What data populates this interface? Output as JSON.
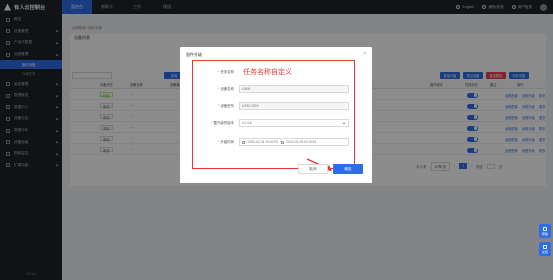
{
  "app": {
    "title": "有人云控制台",
    "version": "V3.1.0"
  },
  "topnav": [
    {
      "label": "监控台",
      "active": true
    },
    {
      "label": "物联卡",
      "active": false
    },
    {
      "label": "工作",
      "active": false
    },
    {
      "label": "模组",
      "active": false
    }
  ],
  "topright": {
    "lang": "English",
    "bell": "通知/反馈",
    "user": "用户信息"
  },
  "sidebar": {
    "items": [
      {
        "label": "概览",
        "icon": "home-icon"
      },
      {
        "label": "设备管理",
        "icon": "device-icon",
        "expand": true
      },
      {
        "label": "产品与数据",
        "icon": "product-icon",
        "expand": true
      },
      {
        "label": "远程管理",
        "icon": "remote-icon",
        "expand": true
      }
    ],
    "subitems": [
      {
        "label": "固件设备",
        "active": true
      },
      {
        "label": "升级任务",
        "active": false
      }
    ],
    "items2": [
      {
        "label": "组态管理",
        "icon": "config-icon"
      },
      {
        "label": "数据转发",
        "icon": "forward-icon"
      },
      {
        "label": "数据中心",
        "icon": "data-icon"
      },
      {
        "label": "设备日志",
        "icon": "log-icon"
      },
      {
        "label": "数据分析",
        "icon": "analysis-icon"
      },
      {
        "label": "设备运维",
        "icon": "ops-icon"
      },
      {
        "label": "视频监控",
        "icon": "video-icon"
      },
      {
        "label": "扩展功能",
        "icon": "ext-icon"
      }
    ]
  },
  "breadcrumb": "远程管理 / 固件设备",
  "card": {
    "title": "设备列表"
  },
  "toolbar": {
    "buttons": [
      {
        "label": "查询",
        "color": "#2d6ee8"
      },
      {
        "label": "批量升级",
        "color": "#2d6ee8"
      },
      {
        "label": "导出设备",
        "color": "#2d6ee8"
      },
      {
        "label": "批量删除",
        "color": "#e8445a"
      },
      {
        "label": "同步设备",
        "color": "#2d6ee8"
      }
    ]
  },
  "table": {
    "headers": [
      "",
      "设备状态",
      "设备名称",
      "设备编号",
      "设备型号",
      "固件版本",
      "在线状态",
      "备注",
      "操作"
    ],
    "rows": [
      {
        "status": "在线",
        "name": "···",
        "links": [
          "远程配置",
          "远程升级",
          "更多"
        ]
      },
      {
        "status": "离线",
        "name": "···",
        "links": [
          "远程配置",
          "远程升级",
          "更多"
        ]
      },
      {
        "status": "离线",
        "name": "···",
        "links": [
          "远程配置",
          "远程升级",
          "更多"
        ]
      },
      {
        "status": "离线",
        "name": "···",
        "links": [
          "远程配置",
          "远程升级",
          "更多"
        ]
      },
      {
        "status": "离线",
        "name": "···",
        "links": [
          "远程配置",
          "远程升级",
          "更多"
        ]
      },
      {
        "status": "离线",
        "name": "···",
        "links": [
          "远程配置",
          "远程升级",
          "更多"
        ]
      }
    ]
  },
  "pager": {
    "total": "共 6 条",
    "size": "10条/页",
    "page": "1",
    "goto": "前往",
    "unit": "页"
  },
  "modal": {
    "title": "固件升级",
    "annotation": "任务名称自定义",
    "fields": {
      "task_label": "任务名称",
      "device_name_label": "设备名称",
      "device_name_value": "G805",
      "device_no_label": "设备型号",
      "device_no_value": "USR-G809",
      "firmware_label": "要升级的版本",
      "firmware_value": "V1.4.6",
      "time_label": "升级时间",
      "time_start": "2022-02-24 19:10:53",
      "time_end": "2022-02-25 23:15:53"
    },
    "cancel": "取消",
    "confirm": "确定"
  },
  "floaters": [
    {
      "label": "帮助"
    },
    {
      "label": "反馈"
    }
  ],
  "colors": {
    "accent": "#2d6ee8",
    "annotation": "#e53935"
  }
}
